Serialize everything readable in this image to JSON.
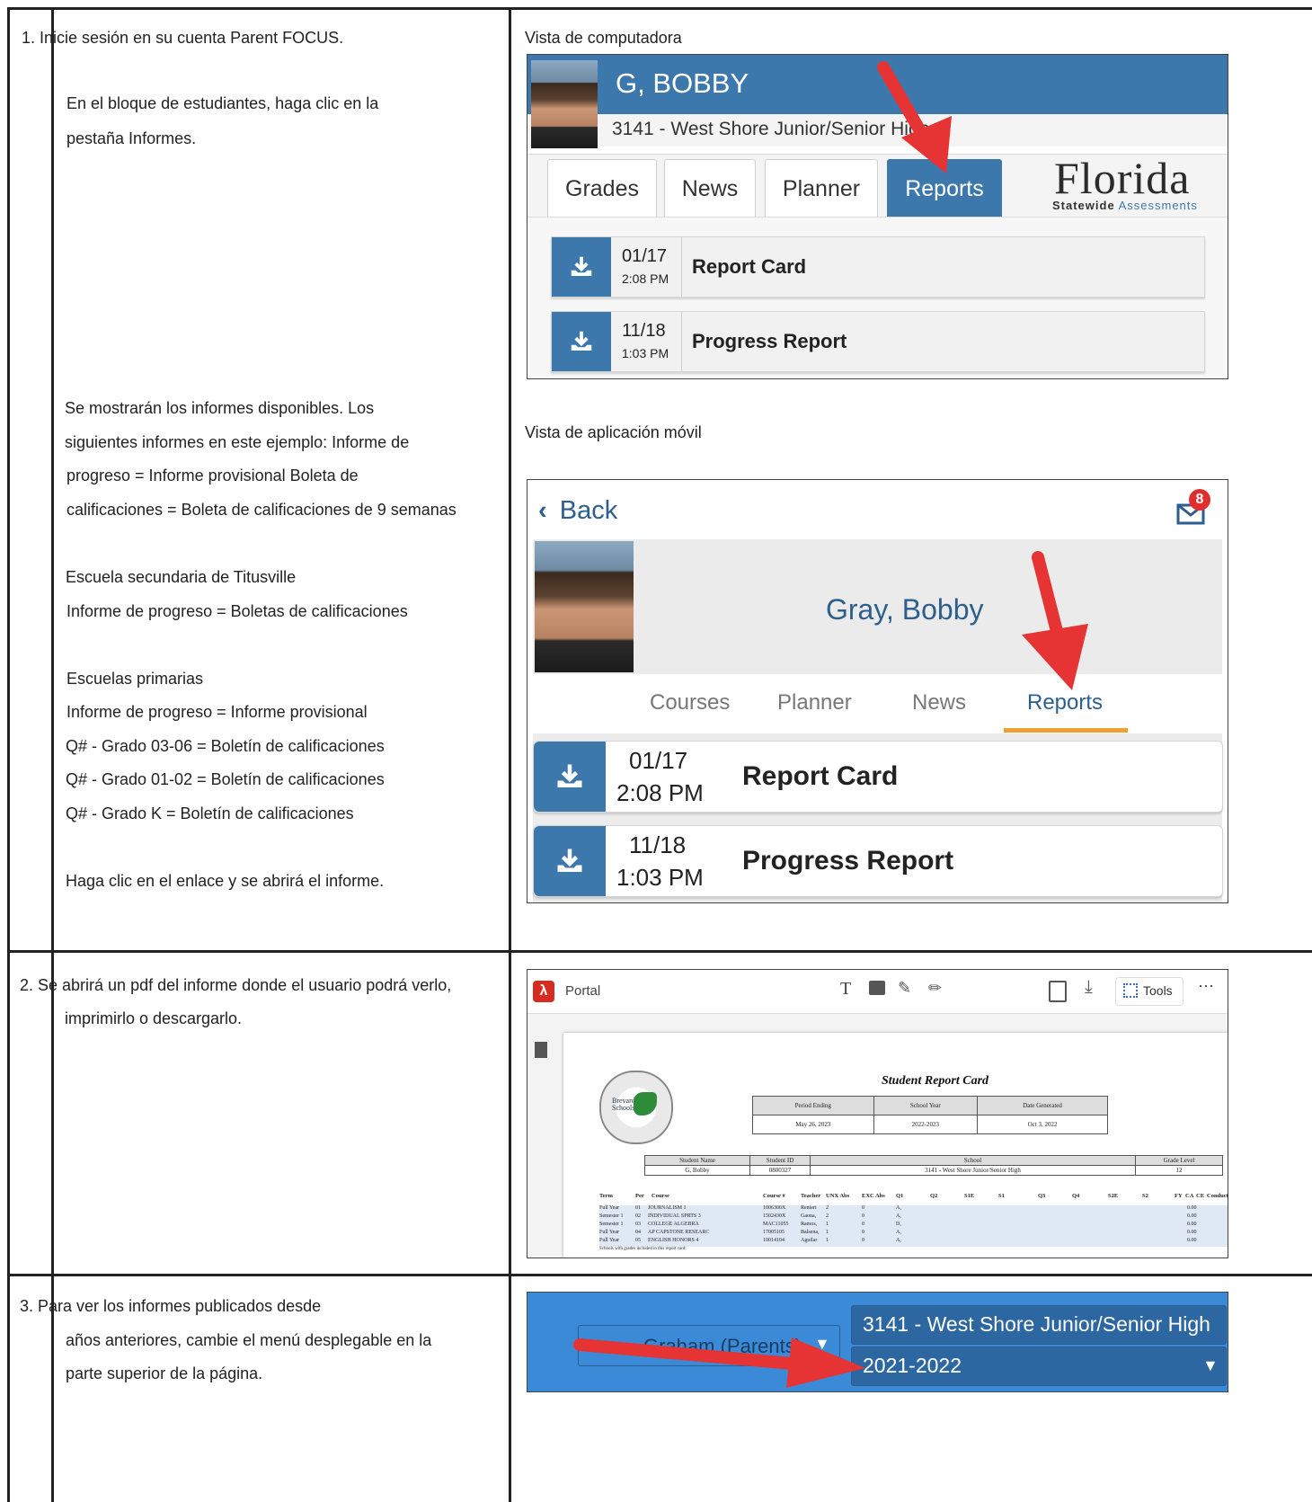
{
  "rows": [
    {
      "paragraphs": [
        "1. Inicie sesión en su cuenta Parent FOCUS.",
        "En el bloque de estudiantes, haga clic en la",
        "pestaña Informes.",
        "Se mostrarán los informes disponibles. Los",
        "siguientes informes en este ejemplo: Informe de",
        "progreso = Informe provisional Boleta de",
        "calificaciones = Boleta de calificaciones de 9 semanas",
        "Escuela secundaria de Titusville",
        "Informe de progreso = Boletas de calificaciones",
        "Escuelas primarias",
        "Informe de progreso = Informe provisional",
        "Q# - Grado 03-06 = Boletín de calificaciones",
        "Q# - Grado 01-02 = Boletín de calificaciones",
        "Q# - Grado K = Boletín de calificaciones",
        "Haga clic en el enlace y se abrirá el informe."
      ]
    },
    {
      "paragraphs": [
        "2. Se abrirá un pdf del informe donde el usuario podrá verlo,",
        "imprimirlo o descargarlo."
      ]
    },
    {
      "paragraphs": [
        "3. Para ver los informes publicados desde",
        "años anteriores, cambie el menú desplegable en la",
        "parte superior de la página."
      ]
    }
  ],
  "desktop_view": {
    "caption": "Vista de computadora",
    "student_name": "G, BOBBY",
    "school": "3141 - West Shore Junior/Senior High",
    "tabs": [
      "Grades",
      "News",
      "Planner",
      "Reports"
    ],
    "logo_word": "Florida",
    "logo_sub_a": "Statewide",
    "logo_sub_b": "Assessments",
    "reports": [
      {
        "date": "01/17",
        "time": "2:08 PM",
        "name": "Report Card"
      },
      {
        "date": "11/18",
        "time": "1:03 PM",
        "name": "Progress Report"
      }
    ]
  },
  "mobile_view": {
    "caption": "Vista de aplicación móvil",
    "back": "Back",
    "badge": "8",
    "student_name": "Gray, Bobby",
    "tabs": [
      "Courses",
      "Planner",
      "News",
      "Reports"
    ],
    "reports": [
      {
        "date": "01/17",
        "time": "2:08 PM",
        "name": "Report Card"
      },
      {
        "date": "11/18",
        "time": "1:03 PM",
        "name": "Progress Report"
      }
    ]
  },
  "pdf_view": {
    "app_label": "Portal",
    "tools_label": "Tools",
    "title": "Student Report Card",
    "seal_text": "Brevard Public Schools",
    "period_headers": [
      "Period Ending",
      "School Year",
      "Date Generated"
    ],
    "period_values": [
      "May 26, 2023",
      "2022-2023",
      "Oct 3, 2022"
    ],
    "student_headers": [
      "Student Name",
      "Student ID",
      "School",
      "Grade Level"
    ],
    "student_values": [
      "G, Bobby",
      "0800327",
      "3141 - West Shore Junior/Senior High",
      "12"
    ],
    "course_headers": [
      "Term",
      "Per",
      "Course",
      "Course #",
      "Teacher",
      "UNX Abs",
      "EXC Abs",
      "Q1",
      "Q2",
      "S1E",
      "S1",
      "Q3",
      "Q4",
      "S2E",
      "S2",
      "FY",
      "CA",
      "CE",
      "Conduct"
    ],
    "courses": [
      [
        "Full Year",
        "01",
        "JOURNALISM 1",
        "1006300X",
        "Renteri",
        "2",
        "0",
        "A,",
        "0.00",
        "0.00"
      ],
      [
        "Semester 1",
        "02",
        "INDIVIDUAL SPRTS 3",
        "1502430X",
        "Gaona,",
        "2",
        "0",
        "A,",
        "0.00",
        "0.00"
      ],
      [
        "Semester 1",
        "03",
        "COLLEGE ALGEBRA",
        "MAC11055",
        "Ramos,",
        "1",
        "0",
        "D,",
        "0.00",
        "0.00"
      ],
      [
        "Full Year",
        "04",
        "AP CAPSTONE RESEARC",
        "17005105",
        "Balsena,",
        "1",
        "0",
        "A,",
        "0.00",
        "0.00"
      ],
      [
        "Full Year",
        "05",
        "ENGLISH HONORS 4",
        "10014104",
        "Aguilar",
        "1",
        "0",
        "A,",
        "0.00",
        "0.00"
      ]
    ],
    "footnote": "Schools with grades included in this report card:"
  },
  "dropdown_view": {
    "user_label": "Graham (Parents)",
    "school_select": "3141 - West Shore Junior/Senior High",
    "year_select": "2021-2022"
  }
}
